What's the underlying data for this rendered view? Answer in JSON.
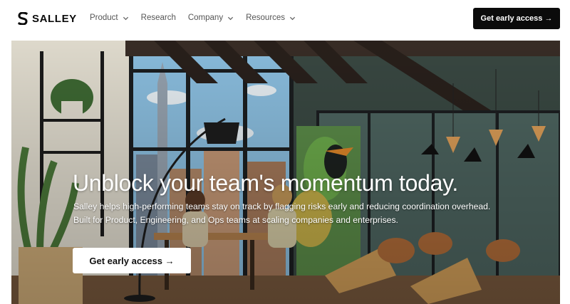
{
  "brand": {
    "name": "SALLEY",
    "logo_icon": "s-logo-icon"
  },
  "nav": {
    "items": [
      {
        "label": "Product",
        "has_dropdown": true
      },
      {
        "label": "Research",
        "has_dropdown": false
      },
      {
        "label": "Company",
        "has_dropdown": true
      },
      {
        "label": "Resources",
        "has_dropdown": true
      }
    ],
    "cta_label": "Get early access →"
  },
  "hero": {
    "title": "Unblock your team's momentum today.",
    "subtitle_line1": "Salley helps high-performing teams stay on track by flagging risks early and reducing coordination overhead.",
    "subtitle_line2": "Built for Product, Engineering, and Ops teams at scaling companies and enterprises.",
    "cta_label": "Get early access →"
  },
  "colors": {
    "primary": "#0b0b0b",
    "background": "#ffffff",
    "hero_text": "#ffffff"
  }
}
